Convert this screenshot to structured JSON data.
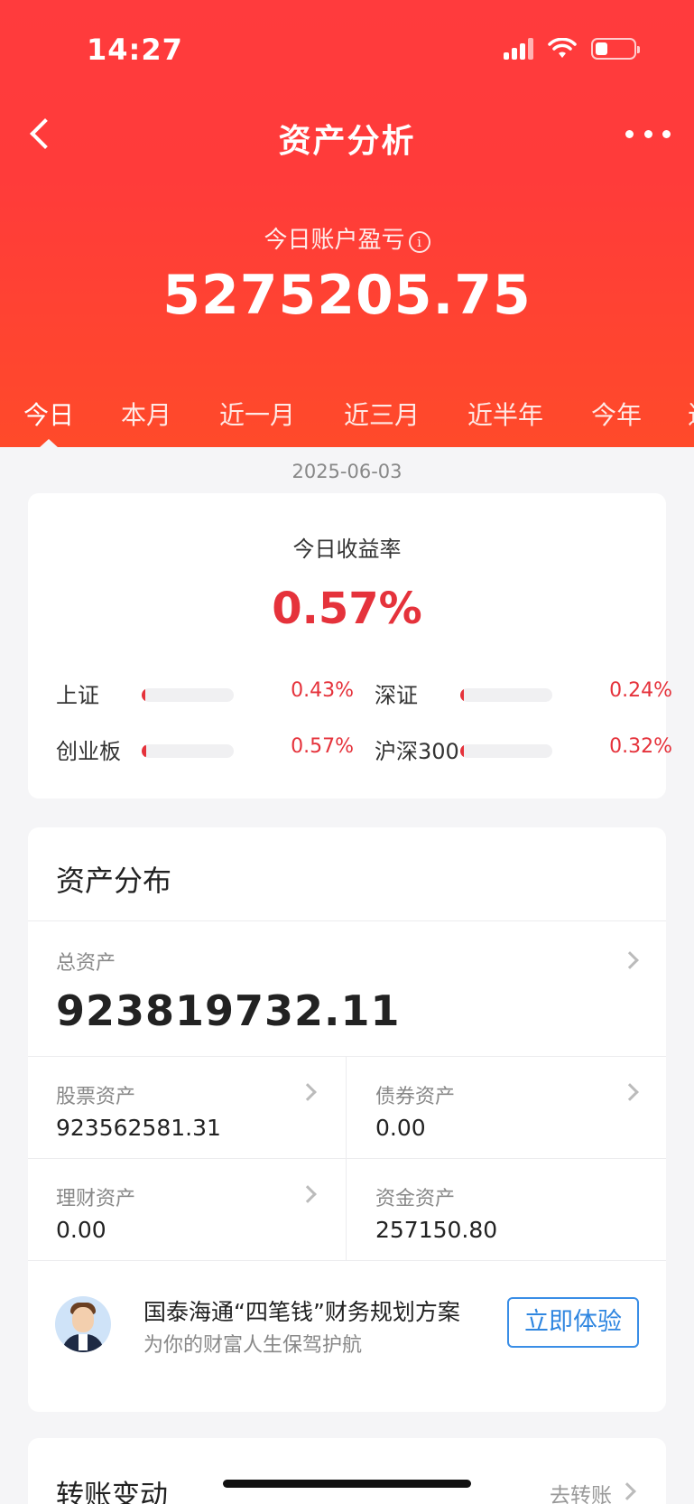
{
  "status_bar": {
    "time": "14:27"
  },
  "nav": {
    "title": "资产分析"
  },
  "pnl": {
    "label": "今日账户盈亏",
    "info_symbol": "i",
    "value": "5275205.75"
  },
  "tabs": [
    "今日",
    "本月",
    "近一月",
    "近三月",
    "近半年",
    "今年",
    "近"
  ],
  "active_tab": "今日",
  "date": "2025-06-03",
  "rate_card": {
    "title": "今日收益率",
    "value": "0.57%",
    "indices": [
      {
        "name": "上证",
        "value": "0.43%",
        "fill_fraction": 0.04
      },
      {
        "name": "深证",
        "value": "0.24%",
        "fill_fraction": 0.02
      },
      {
        "name": "创业板",
        "value": "0.57%",
        "fill_fraction": 0.05
      },
      {
        "name": "沪深300",
        "value": "0.32%",
        "fill_fraction": 0.03
      }
    ]
  },
  "assets": {
    "title": "资产分布",
    "total_label": "总资产",
    "total_value": "923819732.11",
    "cells": [
      {
        "label": "股票资产",
        "value": "923562581.31"
      },
      {
        "label": "债券资产",
        "value": "0.00"
      },
      {
        "label": "理财资产",
        "value": "0.00"
      },
      {
        "label": "资金资产",
        "value": "257150.80"
      }
    ],
    "promo": {
      "title": "国泰海通“四笔钱”财务规划方案",
      "subtitle": "为你的财富人生保驾护航",
      "button": "立即体验"
    }
  },
  "transfer": {
    "title": "转账变动",
    "link": "去转账"
  },
  "colors": {
    "header_red": "#ff3b3d",
    "accent_red": "#e5323b",
    "link_blue": "#2f86e0"
  }
}
